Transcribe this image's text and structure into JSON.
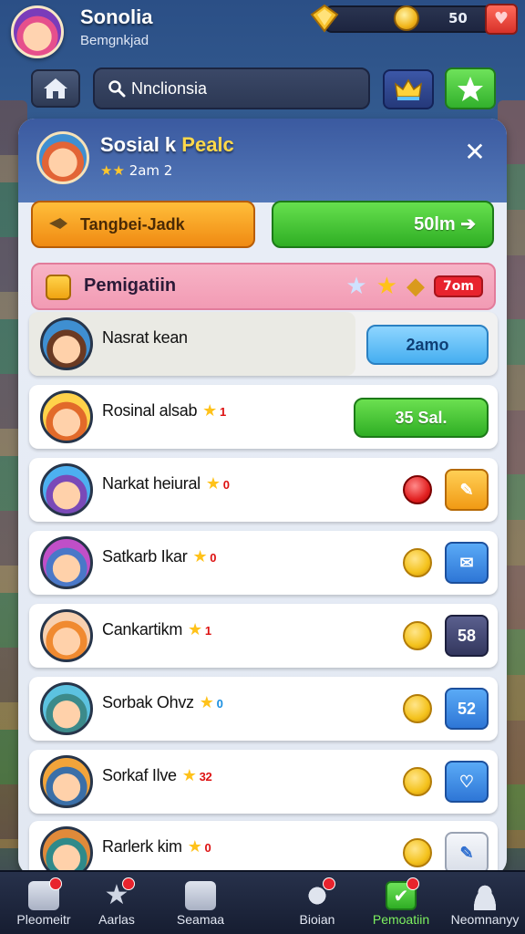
{
  "header": {
    "user_name": "Sonolia",
    "user_subtitle": "Bemgnkjad",
    "resource_value": "50"
  },
  "search": {
    "value": "Nnclionsia"
  },
  "group": {
    "name_part1": "Sosial k",
    "name_part2": "Pealc",
    "rating": "2am 2"
  },
  "actions": {
    "orange_label": "Tangbei-Jadk",
    "green_label": "50lm ➔"
  },
  "list_header": {
    "title": "Pemigatiin",
    "count": "7om"
  },
  "rows": [
    {
      "name": "Nasrat kean",
      "extra": "",
      "action": "2amo",
      "status": "none"
    },
    {
      "name": "Rosinal alsab",
      "extra": "1",
      "action": "35 Sal.",
      "status": "none"
    },
    {
      "name": "Narkat heiural",
      "extra": "0",
      "action": "",
      "status": "red"
    },
    {
      "name": "Satkarb Ikar",
      "extra": "0",
      "action": "",
      "status": "yellow"
    },
    {
      "name": "Cankartikm",
      "extra": "1",
      "action": "58",
      "status": "yellow"
    },
    {
      "name": "Sorbak Ohvz",
      "extra": "0",
      "action": "52",
      "status": "yellow"
    },
    {
      "name": "Sorkaf Ilve",
      "extra": "32",
      "action": "",
      "status": "yellow"
    },
    {
      "name": "Rarlerk kim",
      "extra": "0",
      "action": "",
      "status": "yellow"
    }
  ],
  "nav": [
    {
      "label": "Pleomeitr",
      "icon": "home-icon",
      "badge": true
    },
    {
      "label": "Aarlas",
      "icon": "star-icon",
      "badge": true
    },
    {
      "label": "Seamaa",
      "icon": "mail-icon",
      "badge": false
    },
    {
      "label": "Bioian",
      "icon": "group-icon",
      "badge": true
    },
    {
      "label": "Pemoatiin",
      "icon": "check-icon",
      "badge": true
    },
    {
      "label": "Neomnanyy",
      "icon": "profile-icon",
      "badge": false
    }
  ],
  "colors": {
    "accent_green": "#2fae24",
    "accent_orange": "#f08a12",
    "header_blue": "#3b5aa0",
    "list_header_pink": "#f29bb4"
  }
}
